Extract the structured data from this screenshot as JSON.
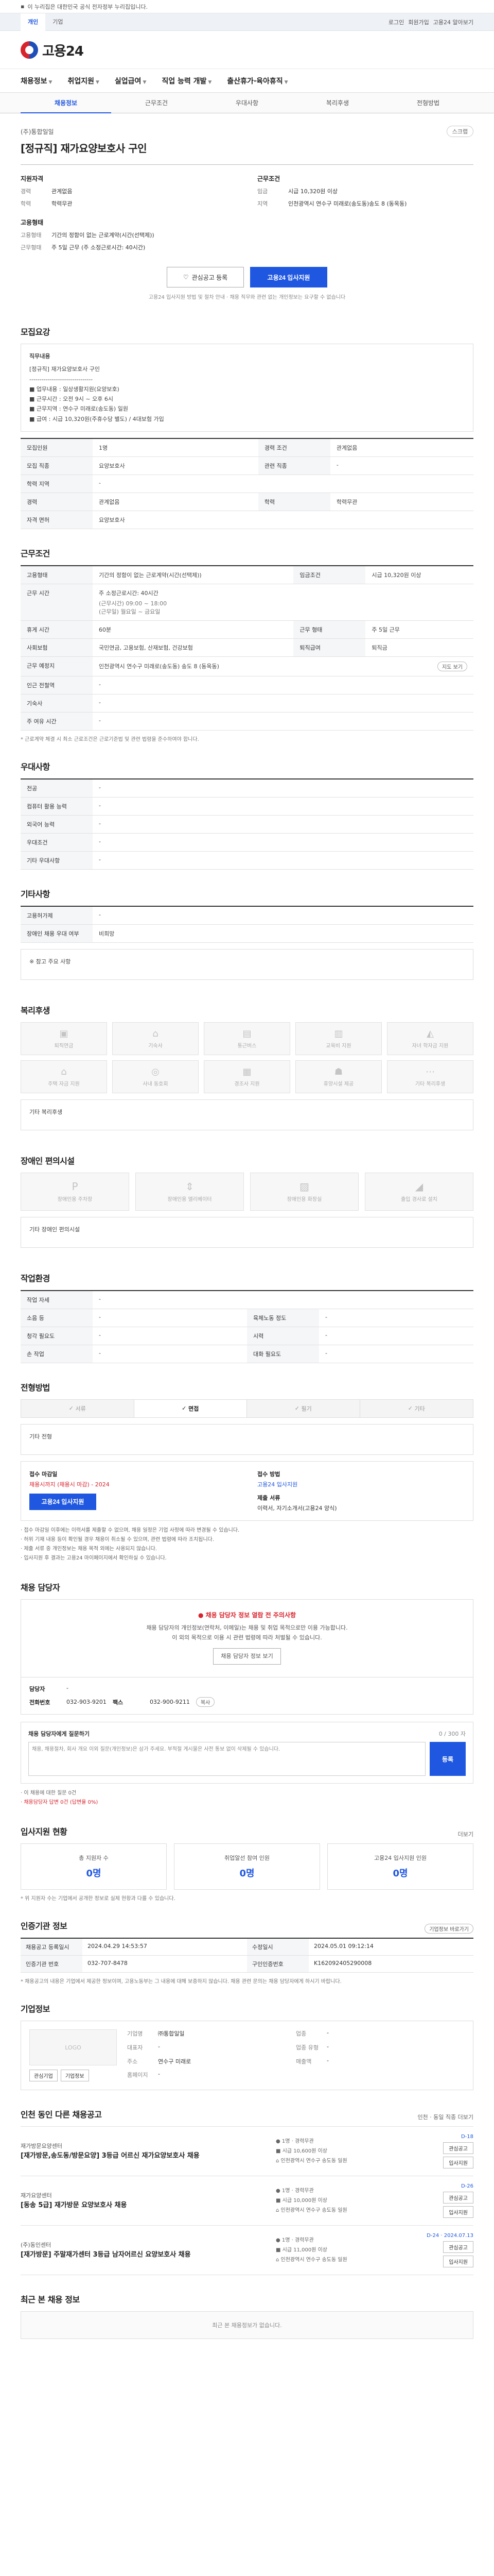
{
  "notice": "이 누리집은 대한민국 공식 전자정부 누리집입니다.",
  "util": {
    "tabs": [
      "개인",
      "기업"
    ],
    "right": [
      "로그인",
      "회원가입",
      "고용24 알아보기"
    ]
  },
  "logo": {
    "name": "고용24"
  },
  "gnb": [
    "채용정보",
    "취업지원",
    "실업급여",
    "직업 능력 개발",
    "출산휴가·육아휴직"
  ],
  "subtabs": [
    "채용정보",
    "근무조건",
    "우대사항",
    "복리후생",
    "전형방법"
  ],
  "summary": {
    "corp": "(주)통합일일",
    "scrap": "스크랩",
    "title": "[정규직] 재가요양보호사 구인",
    "left_h": "지원자격",
    "left": [
      [
        "경력",
        "관계없음"
      ],
      [
        "학력",
        "학력무관"
      ]
    ],
    "left_h2": "고용형태",
    "left2": [
      [
        "고용형태",
        "기간의 정함이 없는 근로계약(시간(선택제))"
      ],
      [
        "근무형태",
        "주 5일 근무 (주 소정근로시간: 40시간)"
      ]
    ],
    "right_h": "근무조건",
    "right": [
      [
        "임금",
        "시급 10,320원 이상"
      ],
      [
        "지역",
        "인천광역시 연수구 미래로(송도동)송도 8 (동옥동)"
      ]
    ],
    "btn_scrap": "관심공고 등록",
    "btn_apply": "고용24 입사지원",
    "cta_note": "고용24 입사지원 방법 및 절차 안내 · 채용 직무와 관련 없는 개인정보는 요구할 수 없습니다"
  },
  "jobdesc": {
    "title": "모집요강",
    "box_title": "직무내용",
    "box_lines": [
      "[정규직] 재가요양보호사 구인",
      "-------------------------------",
      "■ 업무내용 : 일상생활지원(요양보호)",
      "■ 근무시간 : 오전 9시 ~ 오후 6시",
      "■ 근무지역 : 연수구 미래로(송도동) 일원",
      "■ 급여 : 시급 10,320원(주휴수당 별도) / 4대보험 가입"
    ],
    "rows": [
      [
        "모집인원",
        "1명",
        "경력 조건",
        "관계없음"
      ],
      [
        "모집 직종",
        "요양보호사",
        "관련 직종",
        "-"
      ],
      [
        "학력 지역",
        "-",
        "",
        ""
      ],
      [
        "경력",
        "관계없음",
        "학력",
        "학력무관"
      ],
      [
        "자격 면허",
        "요양보호사",
        "",
        ""
      ]
    ]
  },
  "work": {
    "title": "근무조건",
    "rows": [
      [
        "고용형태",
        "기간의 정함이 없는 근로계약(시간(선택제))",
        "임금조건",
        "시급 10,320원 이상"
      ]
    ],
    "time_label": "근무 시간",
    "time_value": "주 소정근로시간: 40시간",
    "time_detail": [
      "(근무시간) 09:00 ~ 18:00",
      "(근무일) 월요일 ~ 금요일"
    ],
    "rows2": [
      [
        "휴게 시간",
        "60분",
        "근무 형태",
        "주 5일 근무"
      ],
      [
        "사회보험",
        "국민연금, 고용보험, 산재보험, 건강보험",
        "퇴직급여",
        "퇴직금"
      ]
    ],
    "place_label": "근무 예정지",
    "place_value": "인천광역시 연수구 미래로(송도동) 송도 8 (동옥동)",
    "map_btn": "지도 보기",
    "rows3": [
      [
        "인근 전철역",
        "-"
      ],
      [
        "기숙사",
        "-"
      ],
      [
        "주 여유 시간",
        "-"
      ]
    ],
    "note": "* 근로계약 체결 시 최소 근로조건은 근로기준법 및 관련 법령을 준수하여야 합니다."
  },
  "pref": {
    "title": "우대사항",
    "rows": [
      [
        "전공",
        "-"
      ],
      [
        "컴퓨터 활용 능력",
        "-"
      ],
      [
        "외국어 능력",
        "-"
      ],
      [
        "우대조건",
        "-"
      ],
      [
        "기타 우대사항",
        "-"
      ]
    ]
  },
  "etc": {
    "title": "기타사항",
    "rows": [
      [
        "고용허가제",
        "-"
      ],
      [
        "장애인 채용 우대 여부",
        "비희망"
      ]
    ],
    "tip": "※ 참고 주요 사항"
  },
  "welfare": {
    "title": "복리후생",
    "cards": [
      "퇴직연금",
      "기숙사",
      "통근버스",
      "교육비 지원",
      "자녀 학자금 지원",
      "주택 자금 지원",
      "사내 동호회",
      "경조사 지원",
      "휴양시설 제공",
      "기타 복리후생"
    ],
    "tip": "기타 복리후생"
  },
  "disabled": {
    "title": "장애인 편의시설",
    "cards": [
      "장애인용 주차장",
      "장애인용 엘리베이터",
      "장애인용 화장실",
      "출입 경사로 설치"
    ],
    "tip": "기타 장애인 편의시설"
  },
  "work_env": {
    "title": "작업환경",
    "rows": [
      [
        "작업 자세",
        "-",
        "",
        ""
      ],
      [
        "소음 등",
        "-",
        "육체노동 정도",
        "-"
      ],
      [
        "청각 필요도",
        "-",
        "시력",
        "-"
      ],
      [
        "손 작업",
        "-",
        "대화 필요도",
        "-"
      ]
    ]
  },
  "process": {
    "title": "전형방법",
    "tabs": [
      "서류",
      "면접",
      "필기",
      "기타"
    ],
    "tab_on": 1,
    "memo": "기타 전형",
    "left_h": "접수 마감일",
    "deadline": "채용시까지 (채용시 마감) - 2024",
    "apply_btn": "고용24 입사지원",
    "right_h": "접수 방법",
    "method": "고용24 입사지원",
    "right_h2": "제출 서류",
    "docs": "이력서, 자기소개서(고용24 양식)",
    "bullets": [
      "· 접수 마감일 이후에는 이력서를 제출할 수 없으며, 채용 일정은 기업 사정에 따라 변경될 수 있습니다.",
      "· 허위 기재 내용 등이 확인될 경우 채용이 취소될 수 있으며, 관련 법령에 따라 조치됩니다.",
      "· 제출 서류 중 개인정보는 채용 목적 외에는 사용되지 않습니다.",
      "· 입사지원 후 결과는 고용24 마이페이지에서 확인하실 수 있습니다."
    ]
  },
  "manager": {
    "title": "채용 담당자",
    "warn": "● 채용 담당자 정보 열람 전 주의사항",
    "lines": [
      "채용 담당자의 개인정보(연락처, 이메일)는 채용 및 취업 목적으로만 이용 가능합니다.",
      "이 외의 목적으로 이용 시 관련 법령에 따라 처벌될 수 있습니다."
    ],
    "btn": "채용 담당자 정보 보기",
    "contact": [
      [
        "담당자",
        "-"
      ],
      [
        "전화번호",
        "032-903-9201"
      ],
      [
        "팩스",
        "032-900-9211"
      ]
    ],
    "copy_btn": "복사",
    "qna_h": "채용 담당자에게 질문하기",
    "qna_meta": "0 / 300 자",
    "qna_ph": "채용, 채용절차, 회사 개요 이외 질문(개인정보)은 삼가 주세요. 부적절 게시물은 사전 통보 없이 삭제될 수 있습니다.",
    "qna_btn": "등록",
    "notes": [
      "· 이 채용에 대한 질문 0건",
      "· 채용담당자 답변 0건 (답변율 0%)"
    ]
  },
  "stats": {
    "title": "입사지원 현황",
    "more": "더보기",
    "items": [
      [
        "총 지원자 수",
        "0명"
      ],
      [
        "취업알선 참여 인원",
        "0명"
      ],
      [
        "고용24 입사지원 인원",
        "0명"
      ]
    ],
    "note": "* 위 지원자 수는 기업에서 공개한 정보로 실제 현황과 다를 수 있습니다."
  },
  "info": {
    "title": "인증기관 정보",
    "btn": "기업정보 바로가기",
    "rows": [
      [
        "채용공고 등록일시",
        "2024.04.29 14:53:57",
        "수정일시",
        "2024.05.01 09:12:14"
      ],
      [
        "인증기관 번호",
        "032-707-8478",
        "구인인증번호",
        "K162092405290008"
      ]
    ],
    "note": "* 채용공고의 내용은 기업에서 제공한 정보이며, 고용노동부는 그 내용에 대해 보증하지 않습니다. 채용 관련 문의는 채용 담당자에게 하시기 바랍니다."
  },
  "corp": {
    "title": "기업정보",
    "logo": "LOGO",
    "btns": [
      "관심기업",
      "기업정보"
    ],
    "info": [
      [
        "기업명",
        "㈜통합일일",
        "업종",
        "-"
      ],
      [
        "대표자",
        "-",
        "업종 유형",
        "-"
      ],
      [
        "주소",
        "연수구 미래로",
        "매출액",
        "-"
      ],
      [
        "홈페이지",
        "-",
        "",
        ""
      ]
    ]
  },
  "others": {
    "title": "인천 동인 다른 채용공고",
    "more": "인천 · 동일 직종 더보기",
    "items": [
      {
        "corp": "재가방문요양센터",
        "title": "[재가방문,송도동/방문요양] 3등급 어르신 재가요양보호사 채용",
        "meta": [
          "● 1명  · 경력무관",
          "■ 시급 10,600원 이상",
          "⌂ 인천광역시 연수구 송도동 일원"
        ],
        "dday": "D-18",
        "btns": [
          "관심공고",
          "입사지원"
        ]
      },
      {
        "corp": "재가요양센터",
        "title": "[동송 5급] 재가방문 요양보호사 채용",
        "meta": [
          "● 1명  · 경력무관",
          "■ 시급 10,000원 이상",
          "⌂ 인천광역시 연수구 송도동 일원"
        ],
        "dday": "D-26",
        "btns": [
          "관심공고",
          "입사지원"
        ]
      },
      {
        "corp": "(주)동인센터",
        "title": "[재가방문] 주말재가센터 3등급 남자어르신 요양보호사 채용",
        "meta": [
          "● 1명  · 경력무관",
          "■ 시급 11,000원 이상",
          "⌂ 인천광역시 연수구 송도동 일원"
        ],
        "dday": "D-24 · 2024.07.13",
        "btns": [
          "관심공고",
          "입사지원"
        ]
      }
    ]
  },
  "recent": {
    "title": "최근 본 채용 정보",
    "empty": "최근 본 채용정보가 없습니다."
  }
}
